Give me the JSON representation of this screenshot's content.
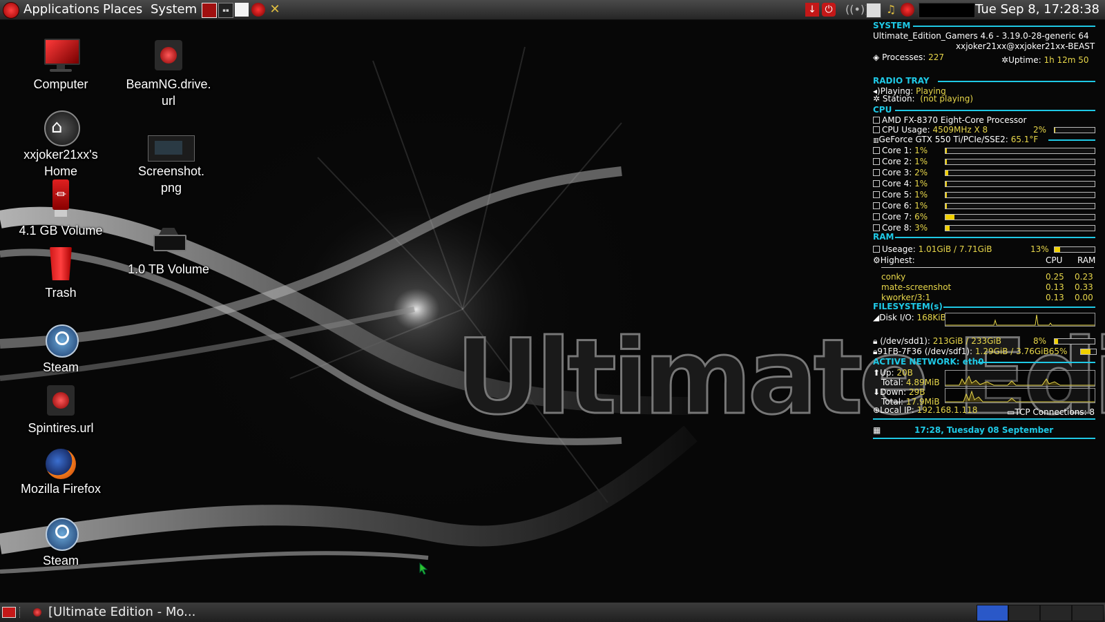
{
  "top_panel": {
    "menus": [
      "Applications",
      "Places",
      "System"
    ],
    "clock": "Tue Sep  8, 17:28:38"
  },
  "desktop": {
    "icons": [
      {
        "label": "Computer",
        "icon": "computer-monitor-icon"
      },
      {
        "label": "BeamNG.drive.\nurl",
        "icon": "beamng-url-icon"
      },
      {
        "label": "xxjoker21xx's\nHome",
        "icon": "home-folder-icon"
      },
      {
        "label": "Screenshot.\npng",
        "icon": "screenshot-thumbnail-icon"
      },
      {
        "label": "4.1 GB Volume",
        "icon": "usb-drive-icon"
      },
      {
        "label": "1.0 TB Volume",
        "icon": "hard-drive-icon"
      },
      {
        "label": "Trash",
        "icon": "trash-icon"
      },
      {
        "label": "Steam",
        "icon": "steam-icon"
      },
      {
        "label": "Spintires.url",
        "icon": "spintires-url-icon"
      },
      {
        "label": "Mozilla Firefox",
        "icon": "firefox-icon"
      },
      {
        "label": "Steam",
        "icon": "steam-icon"
      }
    ]
  },
  "conky": {
    "system": {
      "header": "SYSTEM",
      "os": "Ultimate_Edition_Gamers 4.6 - 3.19.0-28-generic 64",
      "host": "xxjoker21xx@xxjoker21xx-BEAST",
      "processes_label": "Processes:",
      "processes": "227",
      "uptime_label": "Uptime:",
      "uptime": "1h 12m 50"
    },
    "radio": {
      "header": "RADIO TRAY",
      "playing_label": "Playing:",
      "playing": "Playing",
      "station_label": "Station:",
      "station": "(not playing)"
    },
    "cpu": {
      "header": "CPU",
      "processor": "AMD FX-8370 Eight-Core Processor",
      "usage_label": "CPU Usage:",
      "usage_freq": "4509MHz X 8",
      "usage_pct": "2%",
      "usage_frac": 0.02,
      "gpu": "GeForce GTX 550 Ti/PCIe/SSE2:",
      "gpu_temp": "65.1°F",
      "cores": [
        {
          "label": "Core 1:",
          "pct": "1%",
          "frac": 0.01
        },
        {
          "label": "Core 2:",
          "pct": "1%",
          "frac": 0.01
        },
        {
          "label": "Core 3:",
          "pct": "2%",
          "frac": 0.02
        },
        {
          "label": "Core 4:",
          "pct": "1%",
          "frac": 0.01
        },
        {
          "label": "Core 5:",
          "pct": "1%",
          "frac": 0.01
        },
        {
          "label": "Core 6:",
          "pct": "1%",
          "frac": 0.01
        },
        {
          "label": "Core 7:",
          "pct": "6%",
          "frac": 0.06
        },
        {
          "label": "Core 8:",
          "pct": "3%",
          "frac": 0.03
        }
      ]
    },
    "ram": {
      "header": "RAM",
      "usage_label": "Useage:",
      "usage": "1.01GiB / 7.71GiB",
      "usage_pct": "13%",
      "usage_frac": 0.13,
      "highest_label": "Highest:",
      "col_cpu": "CPU",
      "col_ram": "RAM",
      "procs": [
        {
          "name": "conky",
          "cpu": "0.25",
          "ram": "0.23"
        },
        {
          "name": "mate-screenshot",
          "cpu": "0.13",
          "ram": "0.33"
        },
        {
          "name": "kworker/3:1",
          "cpu": "0.13",
          "ram": "0.00"
        }
      ]
    },
    "filesystem": {
      "header": "FILESYSTEM(s)",
      "diskio_label": "Disk I/O:",
      "diskio": "168KiB",
      "fs1_label": "(/dev/sdd1):",
      "fs1": "213GiB / 233GiB",
      "fs1_pct": "8%",
      "fs1_frac": 0.08,
      "fs2_label": "91FB-7F36 (/dev/sdf1):",
      "fs2": "1.29GiB / 3.76GiB",
      "fs2_pct": "65%",
      "fs2_frac": 0.65
    },
    "network": {
      "header": "ACTIVE NETWORK:",
      "iface": "eth0",
      "up_label": "Up:",
      "up": "20B",
      "up_total_label": "Total:",
      "up_total": "4.89MiB",
      "down_label": "Down:",
      "down": "29B",
      "down_total_label": "Total:",
      "down_total": "17.9MiB",
      "ip_label": "Local IP:",
      "ip": "192.168.1.118",
      "tcp_label": "TCP Connections:",
      "tcp": "8"
    },
    "date_line": "17:28, Tuesday 08 September"
  },
  "bottom_panel": {
    "task": "[Ultimate Edition - Mo..."
  },
  "wallpaper": {
    "logo_text": "Ultimate Edition"
  },
  "colors": {
    "accent": "#1fc9e6",
    "value": "#e8d74a",
    "bar_fill": "#f0d000",
    "brand_red": "#d01818"
  }
}
